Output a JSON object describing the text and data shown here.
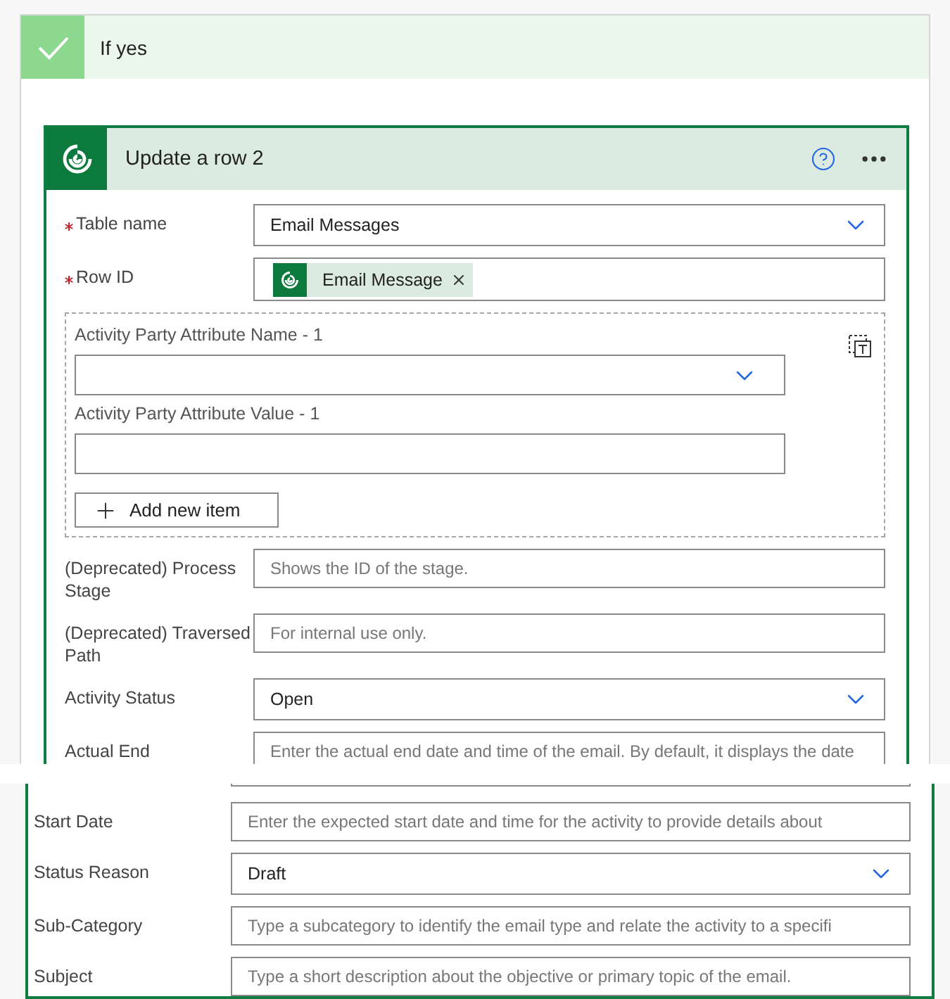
{
  "condition": {
    "title": "If yes"
  },
  "action": {
    "title": "Update a row 2"
  },
  "fields": [
    {
      "kind": "dropdown",
      "label": "Table name",
      "required": true,
      "value": "Email Messages"
    },
    {
      "kind": "tag",
      "label": "Row ID",
      "required": true,
      "tag": "Email Message"
    },
    {
      "kind": "array",
      "items": [
        {
          "kind": "dropdown",
          "label": "Activity Party Attribute Name - 1"
        },
        {
          "kind": "text",
          "label": "Activity Party Attribute Value - 1"
        }
      ],
      "button": "Add new item"
    },
    {
      "kind": "text",
      "label": "(Deprecated) Process Stage",
      "required": false,
      "placeholder": "Shows the ID of the stage."
    },
    {
      "kind": "text",
      "label": "(Deprecated) Traversed Path",
      "required": false,
      "placeholder": "For internal use only."
    },
    {
      "kind": "dropdown",
      "label": "Activity Status",
      "required": false,
      "value": "Open"
    },
    {
      "kind": "text",
      "label": "Actual End",
      "required": false,
      "placeholder": "Enter the actual end date and time of the email. By default, it displays the date"
    }
  ],
  "continued_fields": [
    {
      "kind": "text",
      "label": "Start Date",
      "required": false,
      "placeholder": "Enter the expected start date and time for the activity to provide details about"
    },
    {
      "kind": "dropdown",
      "label": "Status Reason",
      "required": false,
      "value": "Draft"
    },
    {
      "kind": "text",
      "label": "Sub-Category",
      "required": false,
      "placeholder": "Type a subcategory to identify the email type and relate the activity to a specifi"
    },
    {
      "kind": "text",
      "label": "Subject",
      "required": false,
      "placeholder": "Type a short description about the objective or primary topic of the email."
    }
  ]
}
